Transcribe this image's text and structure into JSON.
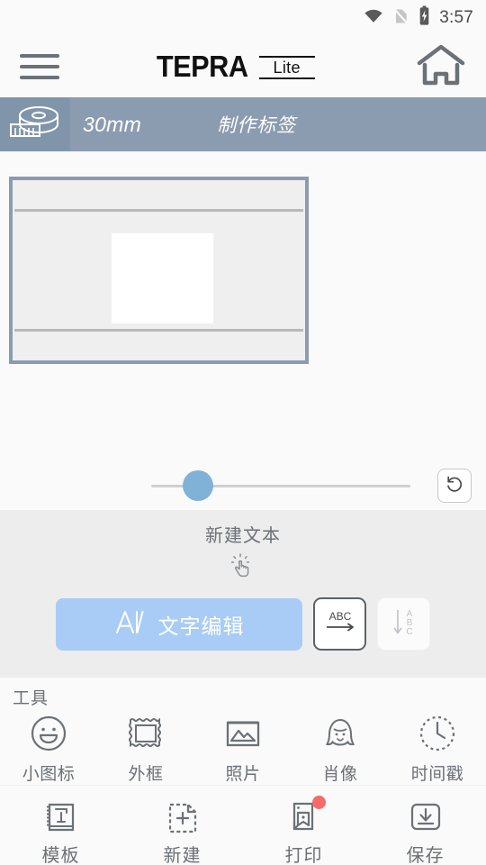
{
  "statusbar": {
    "time": "3:57",
    "icons": [
      "wifi-icon",
      "sim-card-off-icon",
      "battery-charging-icon"
    ]
  },
  "appbar": {
    "menu_icon": "hamburger-menu-icon",
    "brand_main": "TEPRA",
    "brand_sub": "Lite",
    "home_icon": "home-icon"
  },
  "tapebar": {
    "tape_icon": "tape-roll-icon",
    "width": "30mm",
    "mode": "制作标签"
  },
  "canvas": {
    "label_border_color": "#8b9cb0",
    "label_bg_color": "#efefef",
    "textbox_color": "#ffffff"
  },
  "slider": {
    "value_percent": 18,
    "accent": "#7fb2d6",
    "reset_icon": "reset-rotate-icon"
  },
  "text_panel": {
    "title": "新建文本",
    "tap_icon": "tap-hand-icon",
    "edit_button_label": "文字编辑",
    "edit_button_icon": "font-A-icon",
    "edit_button_color": "#a8ccf5",
    "orientation_horizontal_icon": "text-horizontal-abc-icon",
    "orientation_vertical_icon": "text-vertical-abc-icon",
    "orientation_selected": "horizontal"
  },
  "tools": {
    "title": "工具",
    "items": [
      {
        "label": "小图标",
        "icon": "smiley-face-icon"
      },
      {
        "label": "外框",
        "icon": "frame-border-icon"
      },
      {
        "label": "照片",
        "icon": "photo-image-icon"
      },
      {
        "label": "肖像",
        "icon": "portrait-person-icon"
      },
      {
        "label": "时间戳",
        "icon": "clock-timestamp-icon"
      }
    ]
  },
  "bottomnav": {
    "items": [
      {
        "label": "模板",
        "icon": "template-book-icon",
        "badge": false
      },
      {
        "label": "新建",
        "icon": "new-page-plus-icon",
        "badge": false
      },
      {
        "label": "打印",
        "icon": "print-labels-icon",
        "badge": true
      },
      {
        "label": "保存",
        "icon": "save-download-icon",
        "badge": false
      }
    ],
    "badge_color": "#f76a6a"
  }
}
